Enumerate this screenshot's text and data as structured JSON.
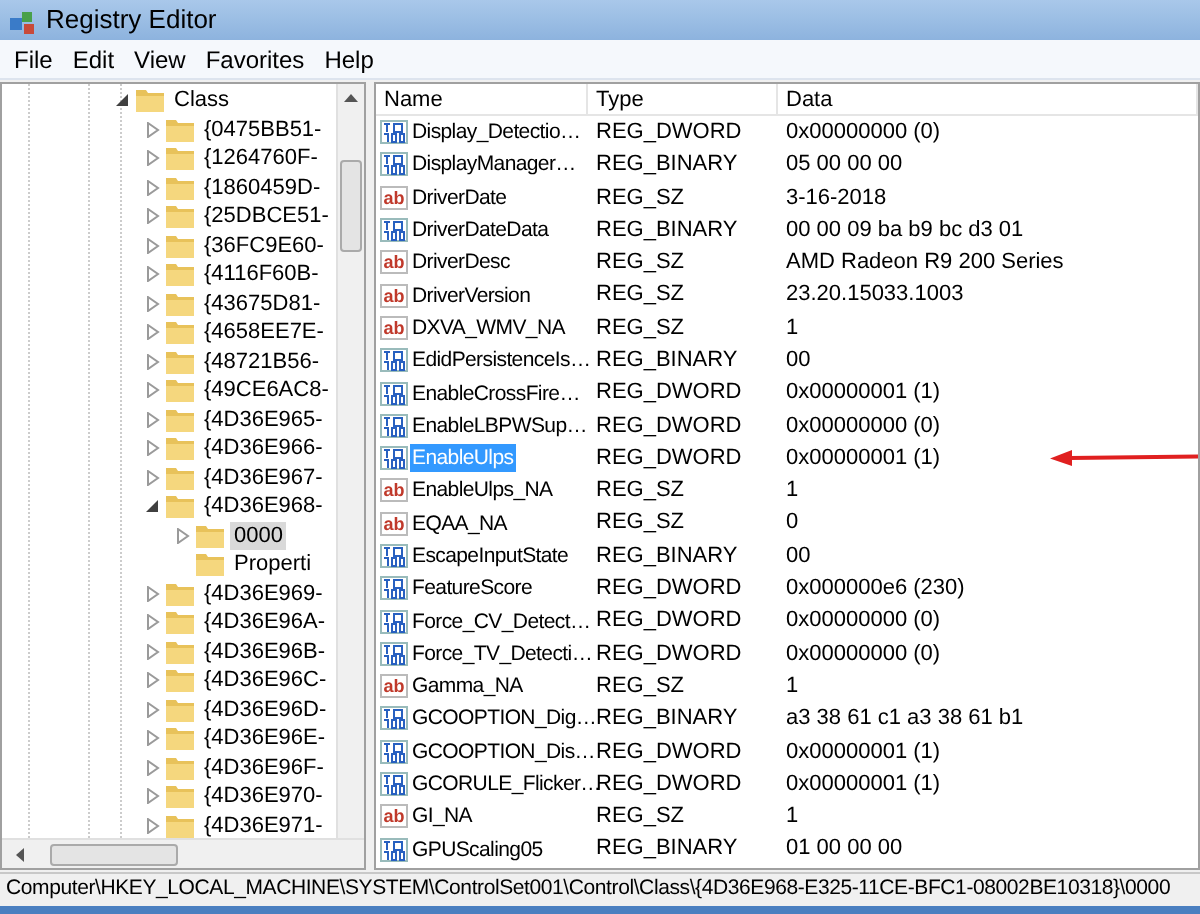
{
  "window": {
    "title": "Registry Editor"
  },
  "menu": [
    "File",
    "Edit",
    "View",
    "Favorites",
    "Help"
  ],
  "tree": [
    {
      "label": "Class",
      "expanded": true,
      "selected": false,
      "children": [
        {
          "label": "{0475BB51-",
          "expanded": false,
          "selected": false
        },
        {
          "label": "{1264760F-",
          "expanded": false,
          "selected": false
        },
        {
          "label": "{1860459D-",
          "expanded": false,
          "selected": false
        },
        {
          "label": "{25DBCE51-",
          "expanded": false,
          "selected": false
        },
        {
          "label": "{36FC9E60-",
          "expanded": false,
          "selected": false
        },
        {
          "label": "{4116F60B-",
          "expanded": false,
          "selected": false
        },
        {
          "label": "{43675D81-",
          "expanded": false,
          "selected": false
        },
        {
          "label": "{4658EE7E-",
          "expanded": false,
          "selected": false
        },
        {
          "label": "{48721B56-",
          "expanded": false,
          "selected": false
        },
        {
          "label": "{49CE6AC8-",
          "expanded": false,
          "selected": false
        },
        {
          "label": "{4D36E965-",
          "expanded": false,
          "selected": false
        },
        {
          "label": "{4D36E966-",
          "expanded": false,
          "selected": false
        },
        {
          "label": "{4D36E967-",
          "expanded": false,
          "selected": false
        },
        {
          "label": "{4D36E968-",
          "expanded": true,
          "selected": false,
          "children": [
            {
              "label": "0000",
              "expanded": false,
              "selected": true
            },
            {
              "label": "Properti",
              "selected": false
            }
          ]
        },
        {
          "label": "{4D36E969-",
          "expanded": false,
          "selected": false
        },
        {
          "label": "{4D36E96A-",
          "expanded": false,
          "selected": false
        },
        {
          "label": "{4D36E96B-",
          "expanded": false,
          "selected": false
        },
        {
          "label": "{4D36E96C-",
          "expanded": false,
          "selected": false
        },
        {
          "label": "{4D36E96D-",
          "expanded": false,
          "selected": false
        },
        {
          "label": "{4D36E96E-",
          "expanded": false,
          "selected": false
        },
        {
          "label": "{4D36E96F-",
          "expanded": false,
          "selected": false
        },
        {
          "label": "{4D36E970-",
          "expanded": false,
          "selected": false
        },
        {
          "label": "{4D36E971-",
          "expanded": false,
          "selected": false
        }
      ]
    }
  ],
  "table": {
    "columns": [
      "Name",
      "Type",
      "Data"
    ],
    "rows": [
      {
        "kind": "binary",
        "name": "Display_Detectio…",
        "type": "REG_DWORD",
        "data": "0x00000000 (0)",
        "selected": false
      },
      {
        "kind": "binary",
        "name": "DisplayManager…",
        "type": "REG_BINARY",
        "data": "05 00 00 00",
        "selected": false
      },
      {
        "kind": "string",
        "icon_label": "ab",
        "name": "DriverDate",
        "type": "REG_SZ",
        "data": "3-16-2018",
        "selected": false
      },
      {
        "kind": "binary",
        "name": "DriverDateData",
        "type": "REG_BINARY",
        "data": "00 00 09 ba b9 bc d3 01",
        "selected": false
      },
      {
        "kind": "string",
        "icon_label": "ab",
        "name": "DriverDesc",
        "type": "REG_SZ",
        "data": "AMD Radeon R9 200 Series",
        "selected": false
      },
      {
        "kind": "string",
        "icon_label": "ab",
        "name": "DriverVersion",
        "type": "REG_SZ",
        "data": "23.20.15033.1003",
        "selected": false
      },
      {
        "kind": "string",
        "icon_label": "ab",
        "name": "DXVA_WMV_NA",
        "type": "REG_SZ",
        "data": "1",
        "selected": false
      },
      {
        "kind": "binary",
        "name": "EdidPersistenceIs…",
        "type": "REG_BINARY",
        "data": "00",
        "selected": false
      },
      {
        "kind": "binary",
        "name": "EnableCrossFire…",
        "type": "REG_DWORD",
        "data": "0x00000001 (1)",
        "selected": false
      },
      {
        "kind": "binary",
        "name": "EnableLBPWSup…",
        "type": "REG_DWORD",
        "data": "0x00000000 (0)",
        "selected": false
      },
      {
        "kind": "binary",
        "name": "EnableUlps",
        "type": "REG_DWORD",
        "data": "0x00000001 (1)",
        "selected": true
      },
      {
        "kind": "string",
        "icon_label": "ab",
        "name": "EnableUlps_NA",
        "type": "REG_SZ",
        "data": "1",
        "selected": false
      },
      {
        "kind": "string",
        "icon_label": "ab",
        "name": "EQAA_NA",
        "type": "REG_SZ",
        "data": "0",
        "selected": false
      },
      {
        "kind": "binary",
        "name": "EscapeInputState",
        "type": "REG_BINARY",
        "data": "00",
        "selected": false
      },
      {
        "kind": "binary",
        "name": "FeatureScore",
        "type": "REG_DWORD",
        "data": "0x000000e6 (230)",
        "selected": false
      },
      {
        "kind": "binary",
        "name": "Force_CV_Detect…",
        "type": "REG_DWORD",
        "data": "0x00000000 (0)",
        "selected": false
      },
      {
        "kind": "binary",
        "name": "Force_TV_Detecti…",
        "type": "REG_DWORD",
        "data": "0x00000000 (0)",
        "selected": false
      },
      {
        "kind": "string",
        "icon_label": "ab",
        "name": "Gamma_NA",
        "type": "REG_SZ",
        "data": "1",
        "selected": false
      },
      {
        "kind": "binary",
        "name": "GCOOPTION_Dig…",
        "type": "REG_BINARY",
        "data": "a3 38 61 c1 a3 38 61 b1",
        "selected": false
      },
      {
        "kind": "binary",
        "name": "GCOOPTION_Dis…",
        "type": "REG_DWORD",
        "data": "0x00000001 (1)",
        "selected": false
      },
      {
        "kind": "binary",
        "name": "GCORULE_Flicker…",
        "type": "REG_DWORD",
        "data": "0x00000001 (1)",
        "selected": false
      },
      {
        "kind": "string",
        "icon_label": "ab",
        "name": "GI_NA",
        "type": "REG_SZ",
        "data": "1",
        "selected": false
      },
      {
        "kind": "binary",
        "name": "GPUScaling05",
        "type": "REG_BINARY",
        "data": "01 00 00 00",
        "selected": false
      }
    ]
  },
  "status_bar": "Computer\\HKEY_LOCAL_MACHINE\\SYSTEM\\ControlSet001\\Control\\Class\\{4D36E968-E325-11CE-BFC1-08002BE10318}\\0000"
}
